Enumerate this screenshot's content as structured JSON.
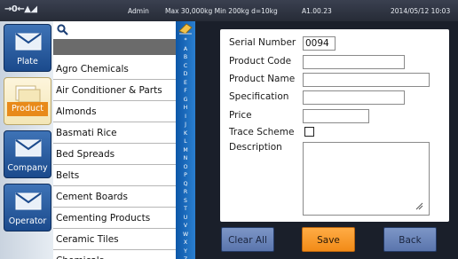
{
  "status": {
    "zero_indicator": "→0←▲◢",
    "user": "Admin",
    "scale_info": "Max 30,000kg  Min 200kg  d=10kg",
    "version": "A1.00.23",
    "datetime": "2014/05/12  10:03"
  },
  "nav": {
    "items": [
      {
        "label": "Plate"
      },
      {
        "label": "Product"
      },
      {
        "label": "Company"
      },
      {
        "label": "Operator"
      }
    ]
  },
  "list": {
    "items": [
      "Agro Chemicals",
      "Air Conditioner & Parts",
      "Almonds",
      "Basmati Rice",
      "Bed Spreads",
      "Belts",
      "Cement Boards",
      "Cementing Products",
      "Ceramic Tiles",
      "Chemicals"
    ]
  },
  "alpha": [
    "*",
    "A",
    "B",
    "C",
    "D",
    "E",
    "F",
    "G",
    "H",
    "I",
    "J",
    "K",
    "L",
    "M",
    "N",
    "O",
    "P",
    "Q",
    "R",
    "S",
    "T",
    "U",
    "V",
    "W",
    "X",
    "Y",
    "Z"
  ],
  "form": {
    "serial_label": "Serial Number",
    "serial_value": "0094",
    "product_code_label": "Product Code",
    "product_code_value": "",
    "product_name_label": "Product Name",
    "product_name_value": "",
    "specification_label": "Specification",
    "specification_value": "",
    "price_label": "Price",
    "price_value": "",
    "trace_label": "Trace Scheme",
    "description_label": "Description",
    "description_value": ""
  },
  "buttons": {
    "clear_all": "Clear All",
    "save": "Save",
    "back": "Back"
  },
  "colors": {
    "accent_blue": "#1b4a8c",
    "save_orange": "#f28b17",
    "index_blue": "#0d57a8"
  }
}
